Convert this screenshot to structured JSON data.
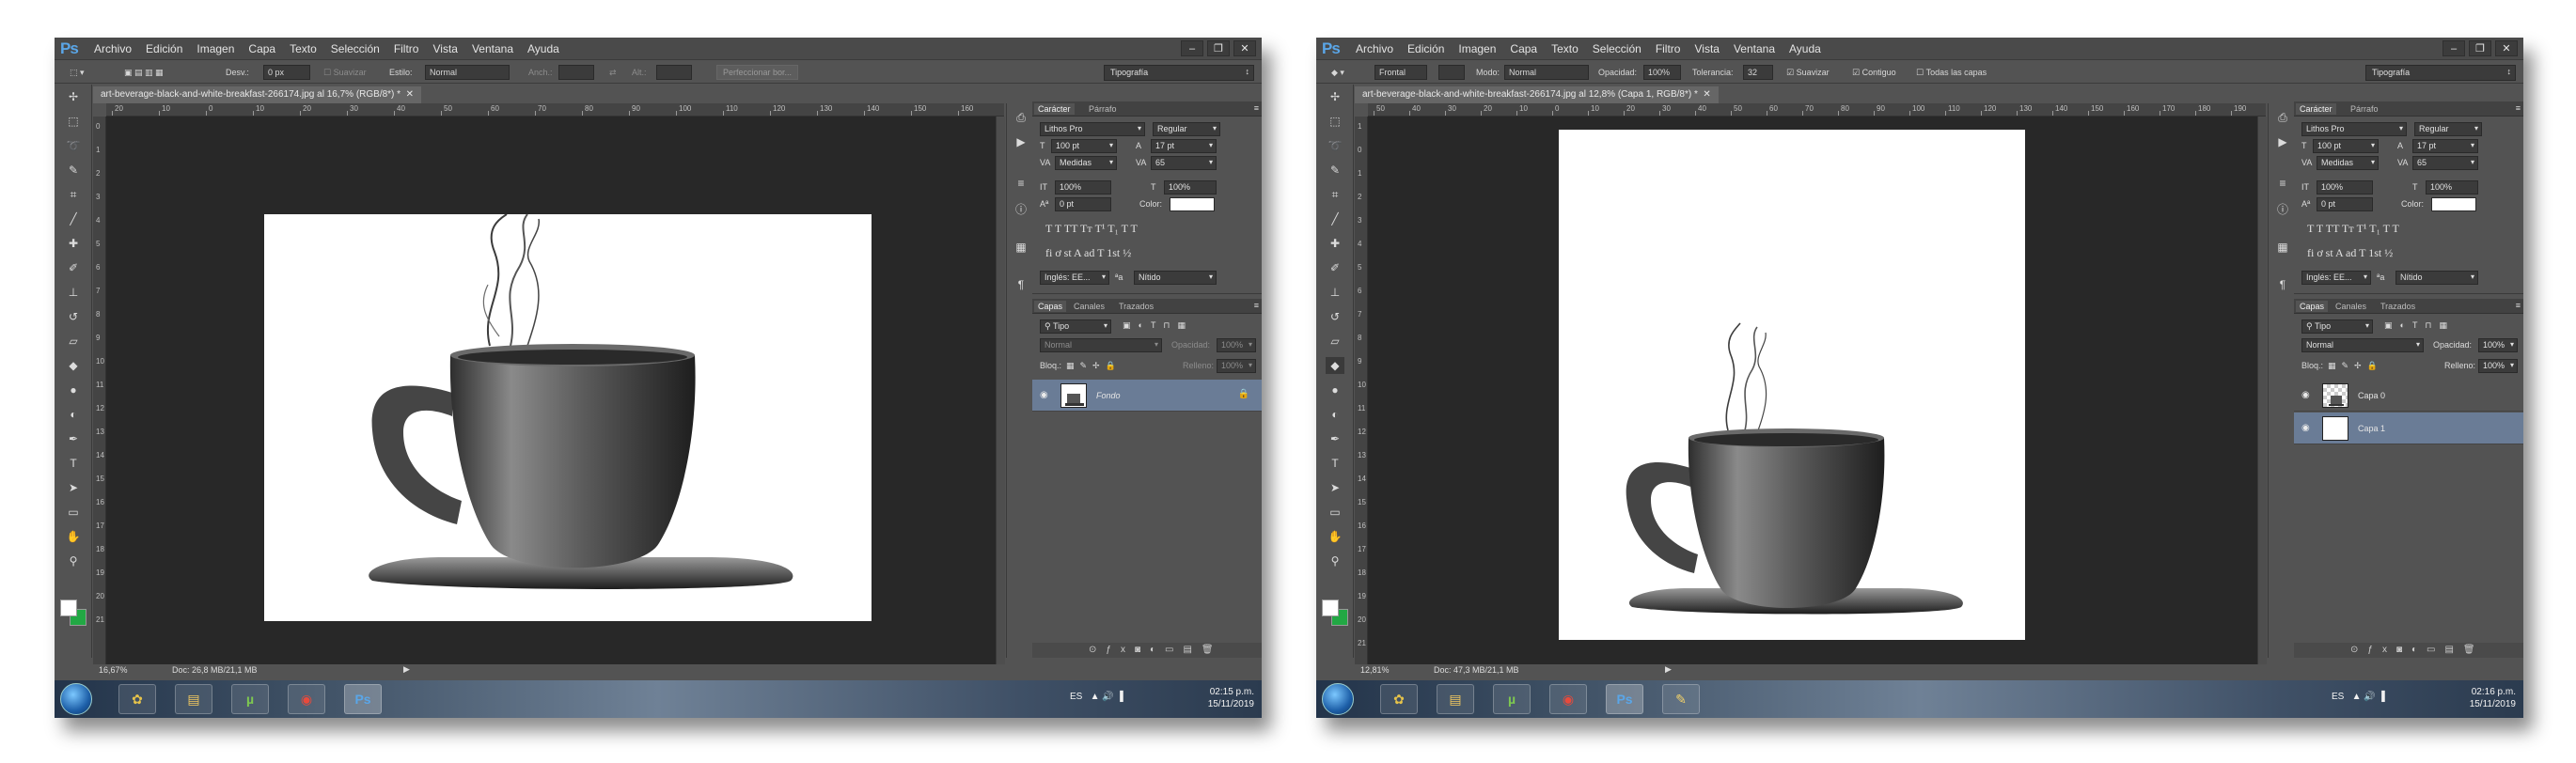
{
  "left": {
    "menu": [
      "Archivo",
      "Edición",
      "Imagen",
      "Capa",
      "Texto",
      "Selección",
      "Filtro",
      "Vista",
      "Ventana",
      "Ayuda"
    ],
    "options": {
      "desv_label": "Desv.:",
      "desv_value": "0 px",
      "suavizar": "Suavizar",
      "estilo_label": "Estilo:",
      "estilo_value": "Normal",
      "anch": "Anch.:",
      "alt": "Alt.:",
      "refine": "Perfeccionar bor...",
      "workspace": "Tipografía"
    },
    "doc_tab": "art-beverage-black-and-white-breakfast-266174.jpg al 16,7% (RGB/8*) *",
    "ruler_h": [
      "20",
      "10",
      "0",
      "10",
      "20",
      "30",
      "40",
      "50",
      "60",
      "70",
      "80",
      "90",
      "100",
      "110",
      "120",
      "130",
      "140",
      "150",
      "160"
    ],
    "ruler_v": [
      "0",
      "1",
      "2",
      "3",
      "4",
      "5",
      "6",
      "7",
      "8",
      "9",
      "10",
      "11",
      "12",
      "13",
      "14",
      "15",
      "16",
      "17",
      "18",
      "19",
      "20",
      "21"
    ],
    "status": {
      "zoom": "16,67%",
      "doc": "Doc: 26,8 MB/21,1 MB"
    },
    "character": {
      "tab1": "Carácter",
      "tab2": "Párrafo",
      "font": "Lithos Pro",
      "style": "Regular",
      "size": "100 pt",
      "leading": "17 pt",
      "kerning": "Medidas",
      "tracking": "65",
      "vscale": "100%",
      "hscale": "100%",
      "baseline": "0 pt",
      "color_label": "Color:",
      "lang": "Inglés: EE...",
      "aa": "Nítido"
    },
    "layers": {
      "tab1": "Capas",
      "tab2": "Canales",
      "tab3": "Trazados",
      "filter": "Tipo",
      "blend": "Normal",
      "opacity_label": "Opacidad:",
      "opacity": "100%",
      "lock_label": "Bloq.:",
      "fill_label": "Relleno:",
      "fill": "100%",
      "items": [
        "Fondo"
      ]
    },
    "clock": {
      "time": "02:15 p.m.",
      "date": "15/11/2019",
      "lang": "ES"
    }
  },
  "right": {
    "menu": [
      "Archivo",
      "Edición",
      "Imagen",
      "Capa",
      "Texto",
      "Selección",
      "Filtro",
      "Vista",
      "Ventana",
      "Ayuda"
    ],
    "options": {
      "frontal": "Frontal",
      "modo_label": "Modo:",
      "modo_value": "Normal",
      "opacidad_label": "Opacidad:",
      "opacidad_value": "100%",
      "tolerancia_label": "Tolerancia:",
      "tolerancia_value": "32",
      "suavizar": "Suavizar",
      "contiguo": "Contiguo",
      "todas": "Todas las capas",
      "workspace": "Tipografía"
    },
    "doc_tab": "art-beverage-black-and-white-breakfast-266174.jpg al 12,8% (Capa 1, RGB/8*) *",
    "ruler_h": [
      "50",
      "40",
      "30",
      "20",
      "10",
      "0",
      "10",
      "20",
      "30",
      "40",
      "50",
      "60",
      "70",
      "80",
      "90",
      "100",
      "110",
      "120",
      "130",
      "140",
      "150",
      "160",
      "170",
      "180",
      "190"
    ],
    "ruler_v": [
      "1",
      "0",
      "1",
      "2",
      "3",
      "4",
      "5",
      "6",
      "7",
      "8",
      "9",
      "10",
      "11",
      "12",
      "13",
      "14",
      "15",
      "16",
      "17",
      "18",
      "19",
      "20",
      "21"
    ],
    "status": {
      "zoom": "12,81%",
      "doc": "Doc: 47,3 MB/21,1 MB"
    },
    "character": {
      "tab1": "Carácter",
      "tab2": "Párrafo",
      "font": "Lithos Pro",
      "style": "Regular",
      "size": "100 pt",
      "leading": "17 pt",
      "kerning": "Medidas",
      "tracking": "65",
      "vscale": "100%",
      "hscale": "100%",
      "baseline": "0 pt",
      "color_label": "Color:",
      "lang": "Inglés: EE...",
      "aa": "Nítido"
    },
    "layers": {
      "tab1": "Capas",
      "tab2": "Canales",
      "tab3": "Trazados",
      "filter": "Tipo",
      "blend": "Normal",
      "opacity_label": "Opacidad:",
      "opacity": "100%",
      "lock_label": "Bloq.:",
      "fill_label": "Relleno:",
      "fill": "100%",
      "items": [
        "Capa 0",
        "Capa 1"
      ]
    },
    "clock": {
      "time": "02:16 p.m.",
      "date": "15/11/2019",
      "lang": "ES"
    }
  },
  "common": {
    "app_logo": "Ps",
    "glyph_row1": "T  T  TT  Tт  T¹  T₁  T  T",
    "glyph_row2": "fi  ơ  st  A  ad  T  1st  ½",
    "win_min": "–",
    "win_max": "❐",
    "win_close": "✕"
  },
  "icons": [
    "move-icon",
    "marquee-icon",
    "lasso-icon",
    "quick-select-icon",
    "crop-icon",
    "eyedropper-icon",
    "heal-icon",
    "brush-icon",
    "stamp-icon",
    "history-brush-icon",
    "eraser-icon",
    "paint-bucket-icon",
    "blur-icon",
    "dodge-icon",
    "pen-icon",
    "type-icon",
    "path-select-icon",
    "shape-icon",
    "hand-icon",
    "zoom-icon",
    "eye-icon",
    "lock-icon",
    "windows-start-icon",
    "chrome-icon",
    "utorrent-icon",
    "folder-icon",
    "photoshop-icon",
    "paint-icon"
  ],
  "colors": {
    "ps_bg": "#535353",
    "canvas_bg": "#282828",
    "accent": "#5aa6e8",
    "layer_sel": "#6a7c96"
  }
}
